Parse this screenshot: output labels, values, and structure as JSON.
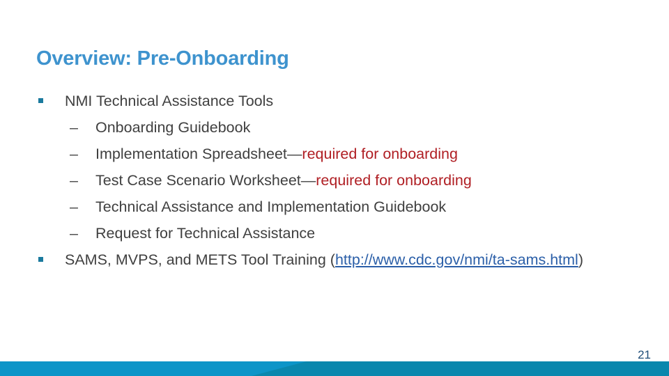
{
  "slide": {
    "title": "Overview: Pre-Onboarding",
    "page_number": "21",
    "colors": {
      "title": "#3e93ce",
      "body_text": "#404040",
      "emphasis_red": "#b01f24",
      "hyperlink": "#2b5fa8",
      "bullet_square": "#1b7a9e",
      "bar_left": "#0d95c8",
      "bar_right": "#0a87ad",
      "page_number": "#1f4e79",
      "background": "#ffffff"
    },
    "bullets": [
      {
        "level": 1,
        "marker": "square-bullet",
        "text": "NMI Technical Assistance Tools"
      },
      {
        "level": 2,
        "marker": "en-dash-bullet",
        "text": "Onboarding Guidebook"
      },
      {
        "level": 2,
        "marker": "en-dash-bullet",
        "text_dark": "Implementation Spreadsheet—",
        "text_red": "required for onboarding"
      },
      {
        "level": 2,
        "marker": "en-dash-bullet",
        "text_dark": "Test Case Scenario Worksheet—",
        "text_red": "required for onboarding"
      },
      {
        "level": 2,
        "marker": "en-dash-bullet",
        "text": "Technical Assistance and Implementation Guidebook"
      },
      {
        "level": 2,
        "marker": "en-dash-bullet",
        "text": "Request for Technical Assistance"
      },
      {
        "level": 1,
        "marker": "square-bullet",
        "text_before": "SAMS, MVPS, and METS Tool Training (",
        "link_text": "http://www.cdc.gov/nmi/ta-sams.html",
        "text_after": ")"
      }
    ],
    "markers": {
      "en_dash": "–"
    }
  }
}
